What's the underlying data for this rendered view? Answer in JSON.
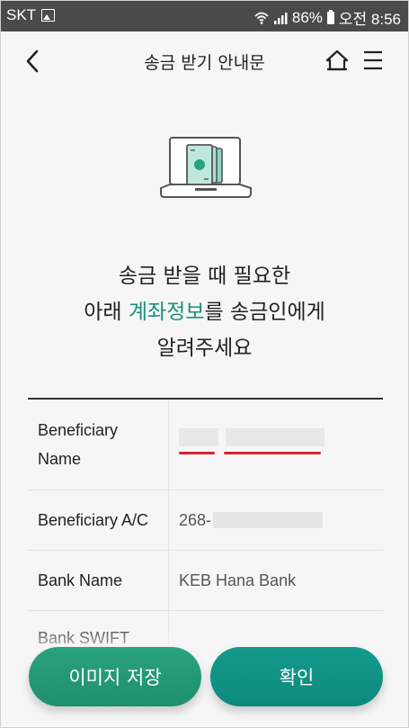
{
  "status_bar": {
    "carrier": "SKT",
    "battery": "86%",
    "time": "오전 8:56"
  },
  "header": {
    "title": "송금 받기 안내문"
  },
  "headline": {
    "line1": "송금 받을 때 필요한",
    "line2_prefix": "아래 ",
    "line2_accent": "계좌정보",
    "line2_suffix": "를 송금인에게",
    "line3": "알려주세요"
  },
  "info": {
    "rows": [
      {
        "label": "Beneficiary\nName",
        "value": ""
      },
      {
        "label": "Beneficiary A/C",
        "value": "268-"
      },
      {
        "label": "Bank Name",
        "value": "KEB Hana Bank"
      },
      {
        "label": "Bank SWIFT",
        "value": ""
      }
    ]
  },
  "buttons": {
    "save": "이미지 저장",
    "ok": "확인"
  },
  "colors": {
    "accent": "#1a8f80",
    "save_button": "#24996f",
    "ok_button": "#119283",
    "highlight_underline": "#d9232d"
  },
  "icons": [
    "back-icon",
    "home-icon",
    "menu-icon",
    "wifi-icon",
    "signal-icon",
    "battery-icon",
    "image-notification-icon"
  ]
}
